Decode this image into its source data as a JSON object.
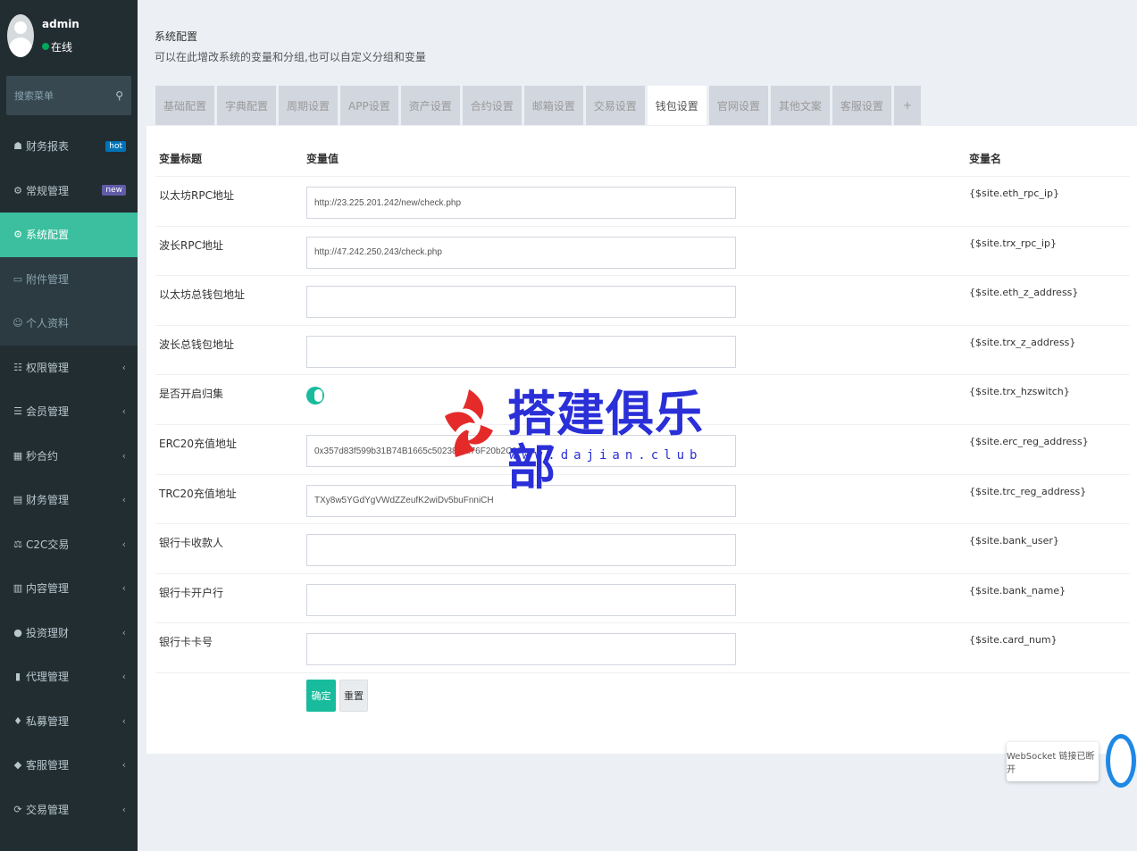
{
  "user": {
    "name": "admin",
    "status": "在线"
  },
  "search": {
    "placeholder": "搜索菜单"
  },
  "menu": [
    {
      "label": "财务报表",
      "icon": "dashboard-icon",
      "badge": "hot",
      "state": "normal"
    },
    {
      "label": "常规管理",
      "icon": "cogs-icon",
      "badge": "new",
      "state": "normal"
    },
    {
      "label": "系统配置",
      "icon": "gear-icon",
      "state": "active"
    },
    {
      "label": "附件管理",
      "icon": "file-icon",
      "state": "sub"
    },
    {
      "label": "个人资料",
      "icon": "user-icon",
      "state": "sub"
    },
    {
      "label": "权限管理",
      "icon": "group-icon",
      "state": "normal",
      "chevron": "‹"
    },
    {
      "label": "会员管理",
      "icon": "list-icon",
      "state": "normal",
      "chevron": "‹"
    },
    {
      "label": "秒合约",
      "icon": "calendar-icon",
      "state": "normal",
      "chevron": "‹"
    },
    {
      "label": "财务管理",
      "icon": "database-icon",
      "state": "normal",
      "chevron": "‹"
    },
    {
      "label": "C2C交易",
      "icon": "balance-icon",
      "state": "normal",
      "chevron": "‹"
    },
    {
      "label": "内容管理",
      "icon": "content-icon",
      "state": "normal",
      "chevron": "‹"
    },
    {
      "label": "投资理财",
      "icon": "circle-icon",
      "state": "normal",
      "chevron": "‹"
    },
    {
      "label": "代理管理",
      "icon": "briefcase-icon",
      "state": "normal",
      "chevron": "‹"
    },
    {
      "label": "私募管理",
      "icon": "diamond-icon",
      "state": "normal",
      "chevron": "‹"
    },
    {
      "label": "客服管理",
      "icon": "comment-icon",
      "state": "normal",
      "chevron": "‹"
    },
    {
      "label": "交易管理",
      "icon": "exchange-icon",
      "state": "normal",
      "chevron": "‹"
    }
  ],
  "page": {
    "title": "系统配置",
    "subtitle": "可以在此增改系统的变量和分组,也可以自定义分组和变量"
  },
  "tabs": [
    "基础配置",
    "字典配置",
    "周期设置",
    "APP设置",
    "资产设置",
    "合约设置",
    "邮箱设置",
    "交易设置",
    "钱包设置",
    "官网设置",
    "其他文案",
    "客服设置",
    "+"
  ],
  "active_tab": "钱包设置",
  "table": {
    "headers": {
      "title": "变量标题",
      "value": "变量值",
      "name": "变量名"
    },
    "rows": [
      {
        "title": "以太坊RPC地址",
        "value": "http://23.225.201.242/new/check.php",
        "var": "{$site.eth_rpc_ip}"
      },
      {
        "title": "波长RPC地址",
        "value": "http://47.242.250.243/check.php",
        "var": "{$site.trx_rpc_ip}"
      },
      {
        "title": "以太坊总钱包地址",
        "value": "",
        "var": "{$site.eth_z_address}"
      },
      {
        "title": "波长总钱包地址",
        "value": "",
        "var": "{$site.trx_z_address}"
      },
      {
        "title": "是否开启归集",
        "value": "",
        "var": "{$site.trx_hzswitch}",
        "toggle": true
      },
      {
        "title": "ERC20充值地址",
        "value": "0x357d83f599b31B74B1665c502384Af76F20b2C09",
        "var": "{$site.erc_reg_address}"
      },
      {
        "title": "TRC20充值地址",
        "value": "TXy8w5YGdYgVWdZZeufK2wiDv5buFnniCH",
        "var": "{$site.trc_reg_address}"
      },
      {
        "title": "银行卡收款人",
        "value": "",
        "var": "{$site.bank_user}"
      },
      {
        "title": "银行卡开户行",
        "value": "",
        "var": "{$site.bank_name}"
      },
      {
        "title": "银行卡卡号",
        "value": "",
        "var": "{$site.card_num}"
      }
    ]
  },
  "buttons": {
    "ok": "确定",
    "reset": "重置"
  },
  "watermark": {
    "text": "搭建俱乐部",
    "url": "www.dajian.club"
  },
  "websocket": {
    "message": "WebSocket 链接已断开"
  },
  "colors": {
    "sidebar": "#222d32",
    "accent": "#3bbf9e",
    "toggle": "#18bc9c"
  }
}
